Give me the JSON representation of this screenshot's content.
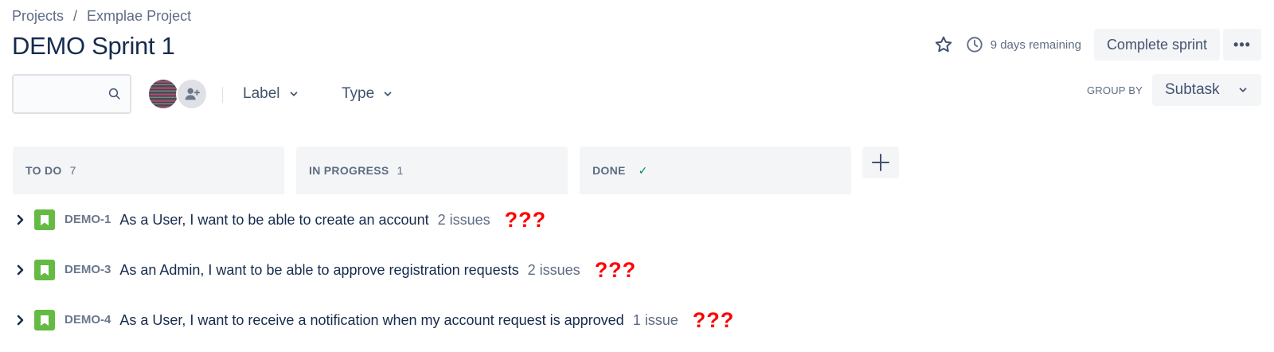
{
  "breadcrumb": {
    "projects": "Projects",
    "separator": "/",
    "project": "Exmplae Project"
  },
  "page_title": "DEMO Sprint 1",
  "header_actions": {
    "star_icon": "star-icon",
    "clock_icon": "clock-icon",
    "remaining": "9 days remaining",
    "complete_label": "Complete sprint",
    "more_label": "•••"
  },
  "toolbar": {
    "search": {
      "value": "",
      "placeholder": ""
    },
    "filters": {
      "label": "Label",
      "type": "Type"
    },
    "group_by_label": "GROUP BY",
    "group_by_value": "Subtask"
  },
  "columns": [
    {
      "title": "TO DO",
      "count": "7"
    },
    {
      "title": "IN PROGRESS",
      "count": "1"
    },
    {
      "title": "DONE",
      "count": "✓"
    }
  ],
  "issues": [
    {
      "key": "DEMO-1",
      "summary": "As a User, I want to be able to create an account",
      "subtasks": "2 issues",
      "note": "???"
    },
    {
      "key": "DEMO-3",
      "summary": "As an Admin, I want to be able to approve registration requests",
      "subtasks": "2 issues",
      "note": "???"
    },
    {
      "key": "DEMO-4",
      "summary": "As a User, I want to receive a notification when my account request is approved",
      "subtasks": "1 issue",
      "note": "???"
    }
  ],
  "colors": {
    "story": "#65BA43",
    "done_check": "#00875A",
    "note": "#FF0000",
    "text": "#172B4D",
    "muted": "#5E6C84"
  }
}
